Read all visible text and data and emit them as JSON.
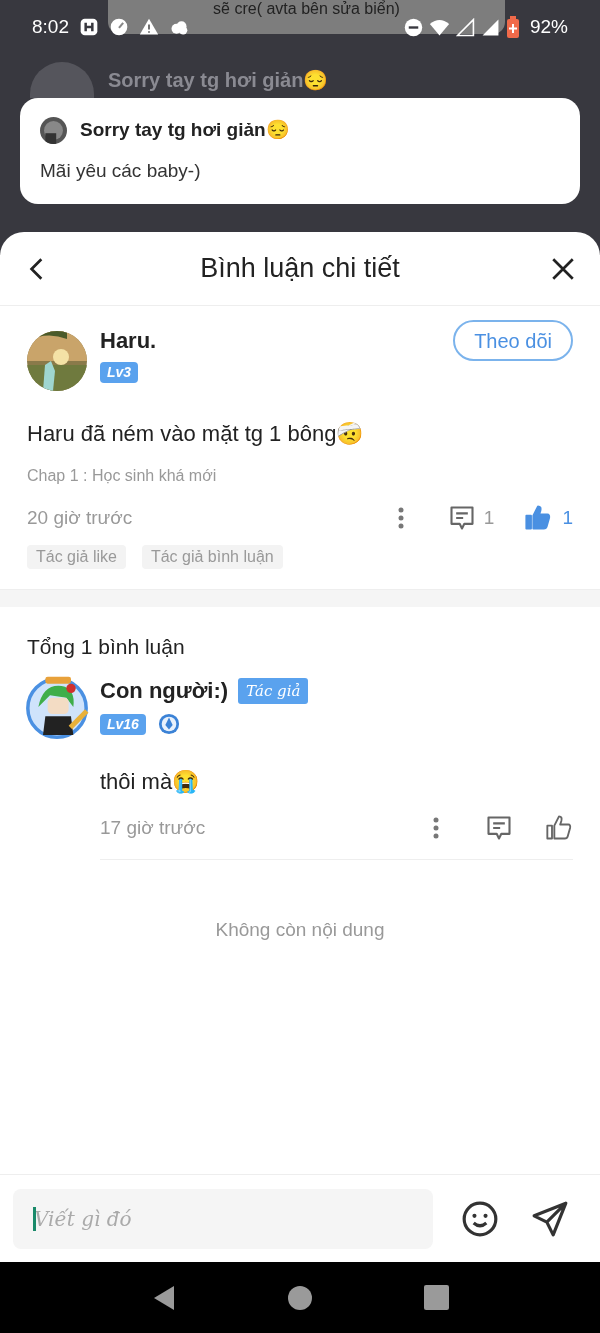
{
  "status_bar": {
    "time": "8:02",
    "battery": "92%"
  },
  "toast": {
    "text": "sẽ cre( avta bên sửa biển)"
  },
  "background_item": {
    "title": "Sorry tay tg hơi giản😔"
  },
  "notification": {
    "title": "Sorry tay tg hơi giản😔",
    "body": "Mãi yêu các baby-)"
  },
  "sheet": {
    "title": "Bình luận chi tiết"
  },
  "comment": {
    "author": "Haru.",
    "level": "Lv3",
    "follow_button": "Theo dõi",
    "text": "Haru đã ném vào mặt tg 1 bông🤕",
    "chapter": "Chap 1 : Học sinh khá mới",
    "time": "20 giờ trước",
    "reply_count": "1",
    "like_count": "1",
    "liked": true,
    "tags": [
      "Tác giả like",
      "Tác giả bình luận"
    ]
  },
  "replies_header": "Tổng 1 bình luận",
  "replies": [
    {
      "author": "Con người:)",
      "author_badge": "Tác giả",
      "level": "Lv16",
      "text": "thôi mà😭",
      "time": "17 giờ trước",
      "liked": false
    }
  ],
  "end_text": "Không còn nội dung",
  "composer": {
    "placeholder": "Viết gì đó"
  }
}
